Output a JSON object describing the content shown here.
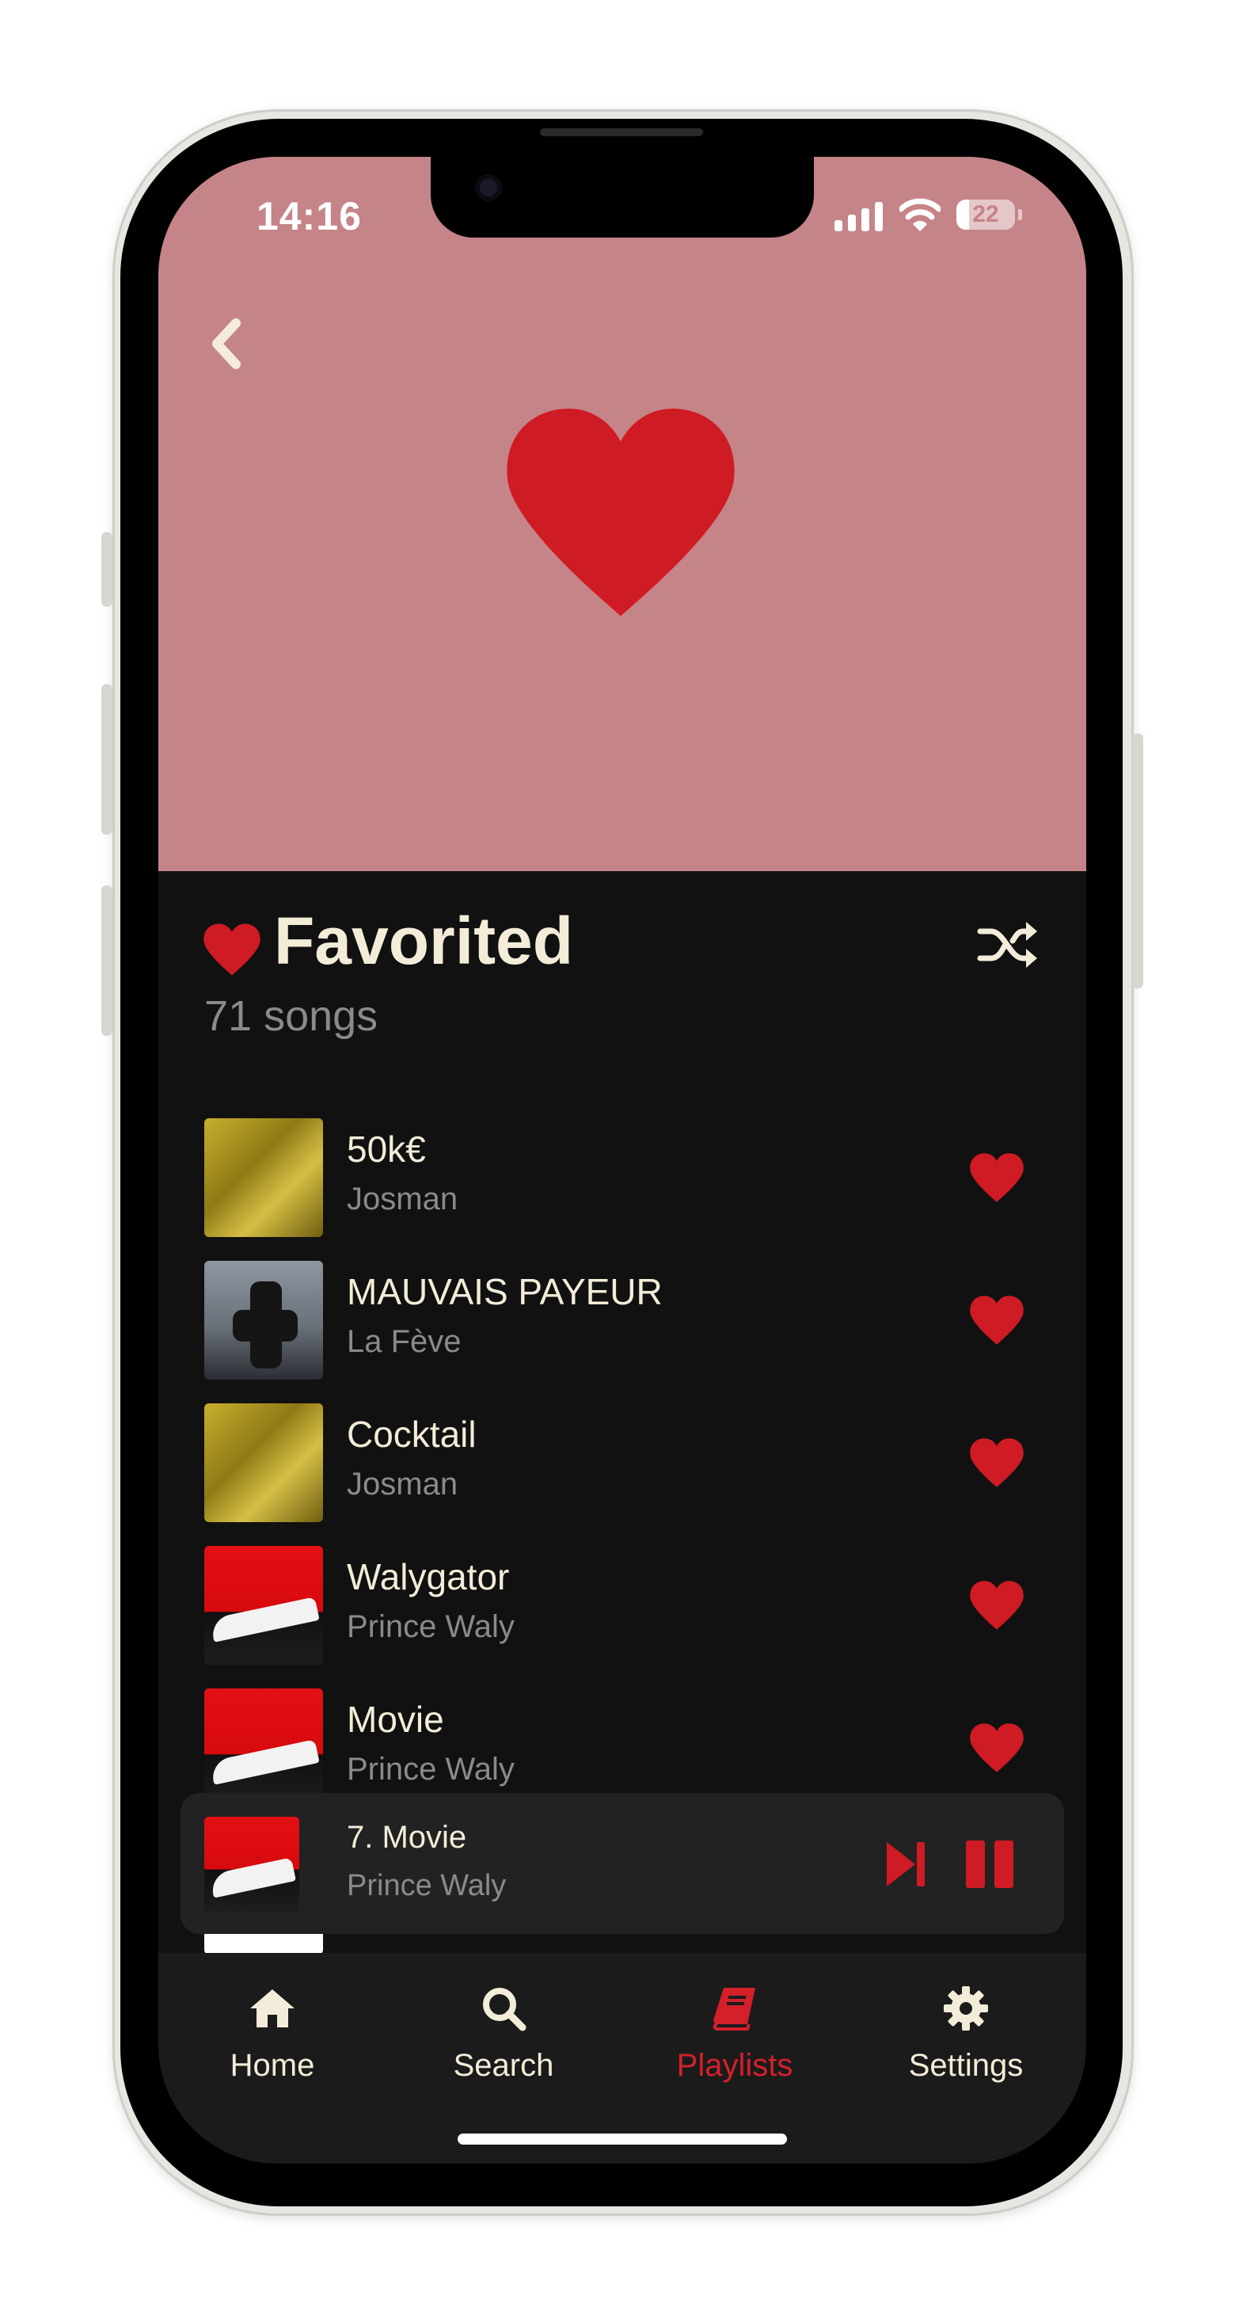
{
  "status_bar": {
    "time": "14:16",
    "battery": "22",
    "battery_level": 0.22
  },
  "playlist": {
    "title": "Favorited",
    "count": "71 songs"
  },
  "colors": {
    "accent": "#d4202a",
    "header_bg": "#c58488",
    "text": "#f3ecd8",
    "muted": "#8a8a8a",
    "background": "#111111"
  },
  "songs": [
    {
      "title": "50k€",
      "artist": "Josman",
      "art": "yellow",
      "favorited": true
    },
    {
      "title": "MAUVAIS PAYEUR",
      "artist": "La Fève",
      "art": "sky",
      "favorited": true
    },
    {
      "title": "Cocktail",
      "artist": "Josman",
      "art": "yellow",
      "favorited": true
    },
    {
      "title": "Walygator",
      "artist": "Prince Waly",
      "art": "red",
      "favorited": true
    },
    {
      "title": "Movie",
      "artist": "Prince Waly",
      "art": "red",
      "favorited": true
    }
  ],
  "now_playing": {
    "title": "7. Movie",
    "artist": "Prince Waly"
  },
  "tabs": [
    {
      "label": "Home",
      "icon": "home-icon"
    },
    {
      "label": "Search",
      "icon": "search-icon"
    },
    {
      "label": "Playlists",
      "icon": "book-icon",
      "active": true
    },
    {
      "label": "Settings",
      "icon": "gear-icon"
    }
  ]
}
